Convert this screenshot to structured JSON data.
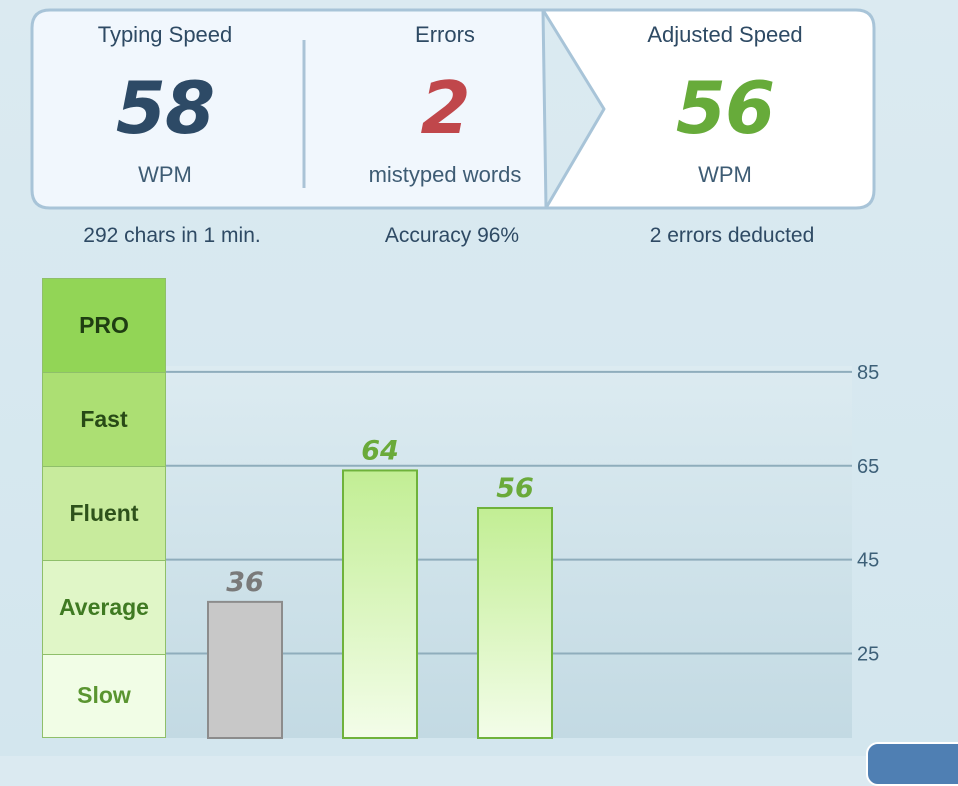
{
  "stats": {
    "typing_speed": {
      "title": "Typing Speed",
      "value": "58",
      "unit": "WPM",
      "color": "#2d4a66"
    },
    "errors": {
      "title": "Errors",
      "value": "2",
      "unit": "mistyped words",
      "color": "#c0474b"
    },
    "adjusted_speed": {
      "title": "Adjusted Speed",
      "value": "56",
      "unit": "WPM",
      "color": "#67ab3a"
    }
  },
  "summary": {
    "chars": "292 chars in 1 min.",
    "accuracy": "Accuracy 96%",
    "deducted": "2 errors deducted"
  },
  "levels": [
    {
      "label": "PRO",
      "bg": "#92d556",
      "color": "#1f3d12"
    },
    {
      "label": "Fast",
      "bg": "#acdf73",
      "color": "#284a16"
    },
    {
      "label": "Fluent",
      "bg": "#c8eb9d",
      "color": "#2e521b"
    },
    {
      "label": "Average",
      "bg": "#e0f6c7",
      "color": "#3f7a22"
    },
    {
      "label": "Slow",
      "bg": "#f1fde6",
      "color": "#5a9530"
    }
  ],
  "chart_data": {
    "type": "bar",
    "y_ticks": [
      25,
      45,
      65,
      85
    ],
    "ylim": [
      7,
      105
    ],
    "grid": true,
    "bars": [
      {
        "value": 36,
        "label": "36",
        "style": "gray"
      },
      {
        "value": 64,
        "label": "64",
        "style": "green"
      },
      {
        "value": 56,
        "label": "56",
        "style": "green"
      }
    ],
    "colors": {
      "gray_fill": "#c8c8c8",
      "gray_stroke": "#8c8c8c",
      "gray_text": "#7a7a7a",
      "green_top": "#c2ee94",
      "green_bottom": "#f3fde9",
      "green_stroke": "#6fb23b",
      "green_text": "#6aaa3a"
    }
  }
}
